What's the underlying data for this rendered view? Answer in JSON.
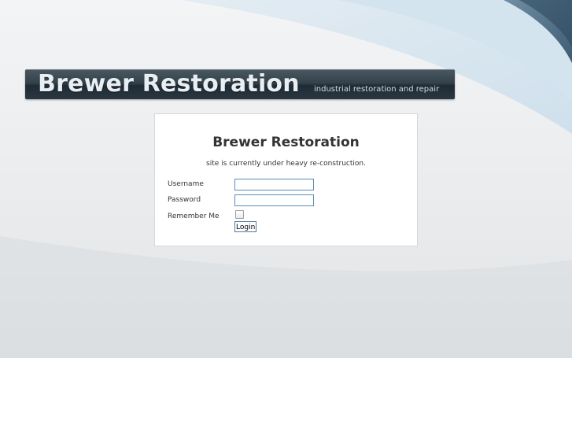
{
  "banner": {
    "title": "Brewer Restoration",
    "tagline": "industrial restoration and repair"
  },
  "login_panel": {
    "title": "Brewer Restoration",
    "subtitle": "site is currently under heavy re-construction.",
    "username_label": "Username",
    "username_value": "",
    "password_label": "Password",
    "password_value": "",
    "remember_label": "Remember Me",
    "remember_checked": false,
    "login_button_label": "Login"
  },
  "colors": {
    "banner_bg": "#2a3741",
    "field_border": "#5a8cb4",
    "swoosh": "#b9d2e3"
  }
}
